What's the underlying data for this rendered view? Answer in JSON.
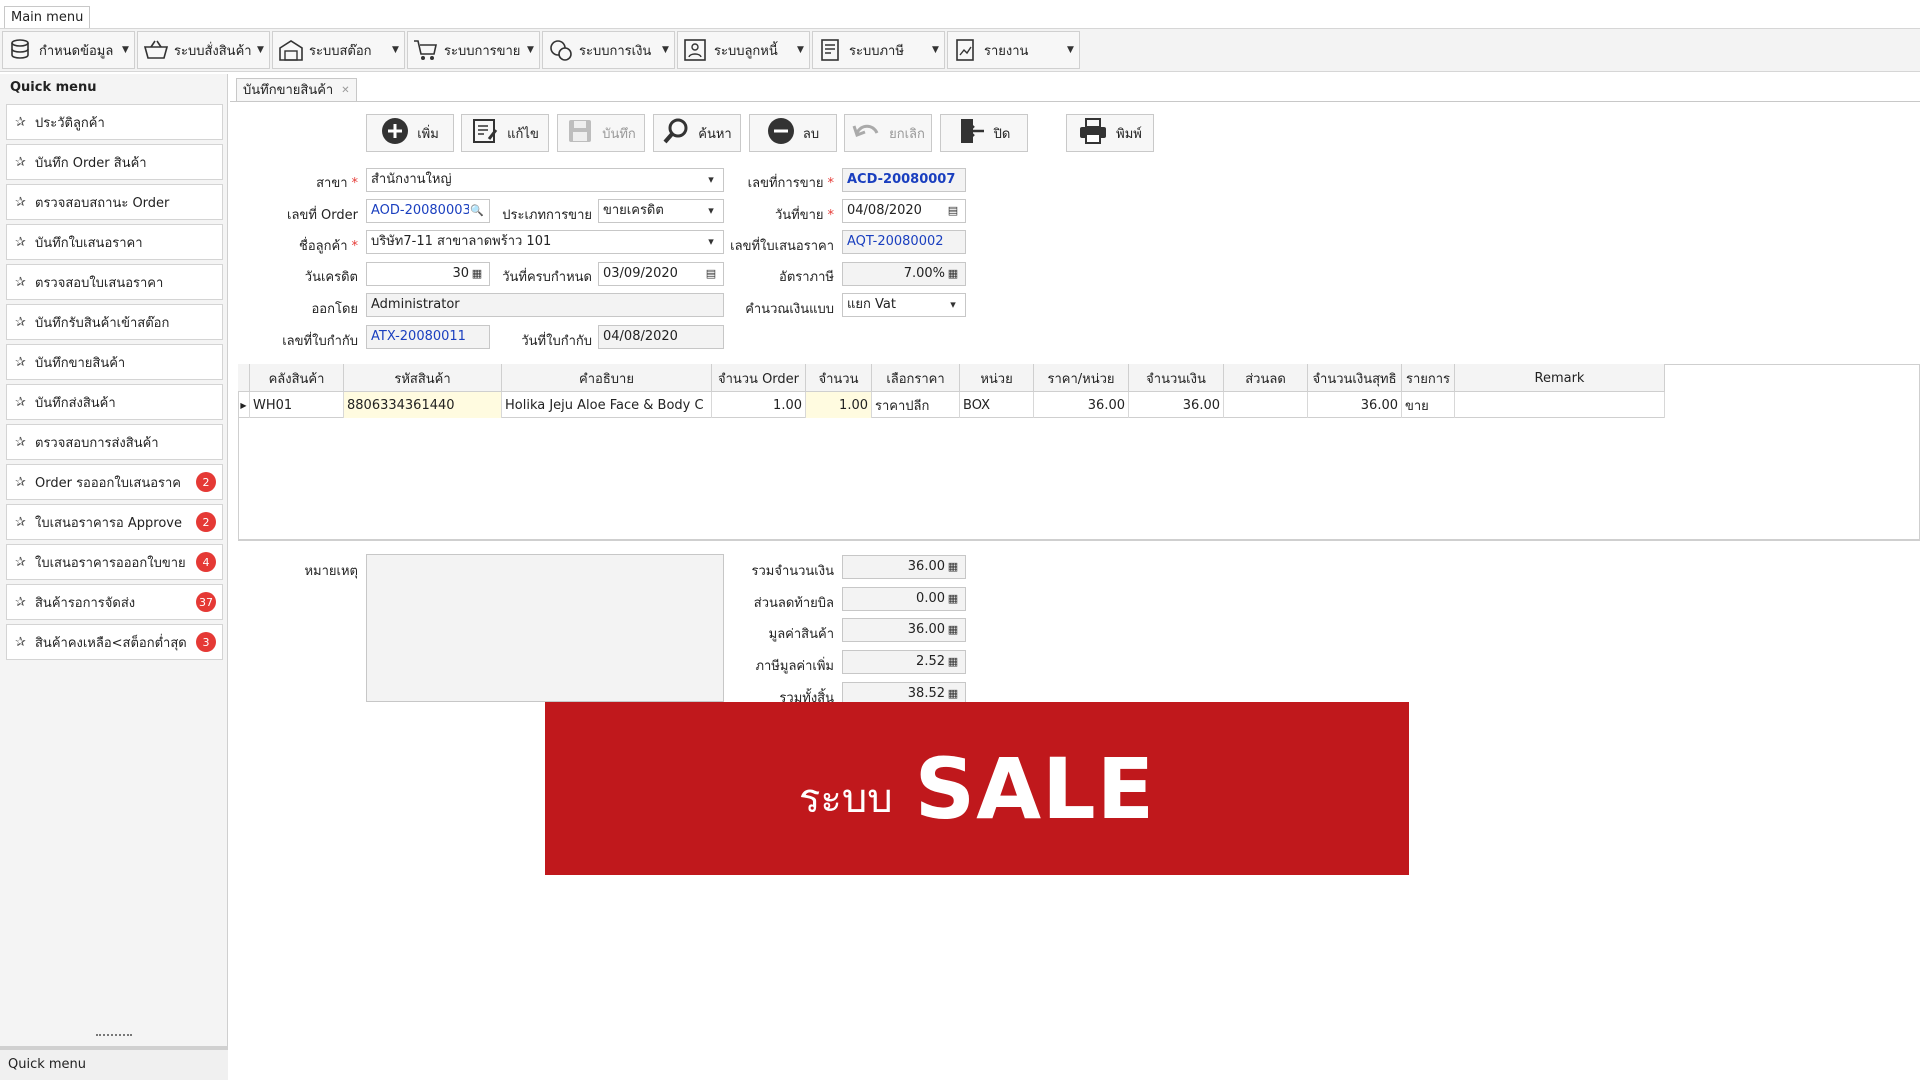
{
  "main_menu_tab": "Main menu",
  "ribbon": [
    {
      "label": "กำหนดข้อมูล",
      "icon": "database-icon"
    },
    {
      "label": "ระบบสั่งสินค้า",
      "icon": "basket-icon"
    },
    {
      "label": "ระบบสต๊อก",
      "icon": "warehouse-icon"
    },
    {
      "label": "ระบบการขาย",
      "icon": "cart-icon"
    },
    {
      "label": "ระบบการเงิน",
      "icon": "coins-icon"
    },
    {
      "label": "ระบบลูกหนี้",
      "icon": "debtor-icon"
    },
    {
      "label": "ระบบภาษี",
      "icon": "tax-document-icon"
    },
    {
      "label": "รายงาน",
      "icon": "report-icon"
    }
  ],
  "quick_menu": {
    "title": "Quick menu",
    "bottom_label": "Quick menu",
    "items": [
      {
        "label": "ประวัติลูกค้า",
        "badge": ""
      },
      {
        "label": "บันทึก Order สินค้า",
        "badge": ""
      },
      {
        "label": "ตรวจสอบสถานะ Order",
        "badge": ""
      },
      {
        "label": "บันทึกใบเสนอราคา",
        "badge": ""
      },
      {
        "label": "ตรวจสอบใบเสนอราคา",
        "badge": ""
      },
      {
        "label": "บันทึกรับสินค้าเข้าสต๊อก",
        "badge": ""
      },
      {
        "label": "บันทึกขายสินค้า",
        "badge": ""
      },
      {
        "label": "บันทึกส่งสินค้า",
        "badge": ""
      },
      {
        "label": "ตรวจสอบการส่งสินค้า",
        "badge": ""
      },
      {
        "label": "Order รอออกใบเสนอราค",
        "badge": "2"
      },
      {
        "label": "ใบเสนอราคารอ Approve",
        "badge": "2"
      },
      {
        "label": "ใบเสนอราคารอออกใบขาย",
        "badge": "4"
      },
      {
        "label": "สินค้ารอการจัดส่ง",
        "badge": "37"
      },
      {
        "label": "สินค้าคงเหลือ<สต็อกต่ำสุด",
        "badge": "3"
      }
    ]
  },
  "doc_tab": "บันทึกขายสินค้า",
  "toolbar": {
    "add": "เพิ่ม",
    "edit": "แก้ไข",
    "save": "บันทึก",
    "search": "ค้นหา",
    "delete": "ลบ",
    "cancel": "ยกเลิก",
    "close": "ปิด",
    "print": "พิมพ์"
  },
  "form": {
    "branch_label": "สาขา",
    "branch_value": "สำนักงานใหญ่",
    "order_no_label": "เลขที่ Order",
    "order_no_value": "AOD-20080003",
    "sale_type_label": "ประเภทการขาย",
    "sale_type_value": "ขายเครดิต",
    "customer_label": "ชื่อลูกค้า",
    "customer_value": "บริษัท7-11 สาขาลาดพร้าว 101",
    "credit_days_label": "วันเครดิต",
    "credit_days_value": "30",
    "due_date_label": "วันที่ครบกำหนด",
    "due_date_value": "03/09/2020",
    "issued_by_label": "ออกโดย",
    "issued_by_value": "Administrator",
    "tax_invoice_no_label": "เลขที่ใบกำกับ",
    "tax_invoice_no_value": "ATX-20080011",
    "tax_invoice_date_label": "วันที่ใบกำกับ",
    "tax_invoice_date_value": "04/08/2020",
    "sale_no_label": "เลขที่การขาย",
    "sale_no_value": "ACD-20080007",
    "sale_date_label": "วันที่ขาย",
    "sale_date_value": "04/08/2020",
    "quotation_no_label": "เลขที่ใบเสนอราคา",
    "quotation_no_value": "AQT-20080002",
    "tax_rate_label": "อัตราภาษี",
    "tax_rate_value": "7.00%",
    "calc_mode_label": "คำนวณเงินแบบ",
    "calc_mode_value": "แยก Vat"
  },
  "grid": {
    "headers": [
      "คลังสินค้า",
      "รหัสสินค้า",
      "คำอธิบาย",
      "จำนวน Order",
      "จำนวน",
      "เลือกราคา",
      "หน่วย",
      "ราคา/หน่วย",
      "จำนวนเงิน",
      "ส่วนลด",
      "จำนวนเงินสุทธิ",
      "รายการ",
      "Remark"
    ],
    "rows": [
      {
        "warehouse": "WH01",
        "code": "8806334361440",
        "description": "Holika Jeju Aloe Face & Body C",
        "order_qty": "1.00",
        "qty": "1.00",
        "price_type": "ราคาปลีก",
        "unit": "BOX",
        "unit_price": "36.00",
        "amount": "36.00",
        "discount": "",
        "net_amount": "36.00",
        "item_type": "ขาย",
        "remark": ""
      }
    ]
  },
  "summary": {
    "remark_label": "หมายเหตุ",
    "total_label": "รวมจำนวนเงิน",
    "total_value": "36.00",
    "bill_discount_label": "ส่วนลดท้ายบิล",
    "bill_discount_value": "0.00",
    "goods_value_label": "มูลค่าสินค้า",
    "goods_value_value": "36.00",
    "vat_label": "ภาษีมูลค่าเพิ่ม",
    "vat_value": "2.52",
    "grand_total_label": "รวมทั้งสิ้น",
    "grand_total_value": "38.52"
  },
  "banner": {
    "prefix": "ระบบ",
    "title": "SALE"
  },
  "colors": {
    "banner": "#c0181c",
    "badge": "#e53935",
    "doc_link": "#1a3fbf",
    "required": "#e53935"
  }
}
